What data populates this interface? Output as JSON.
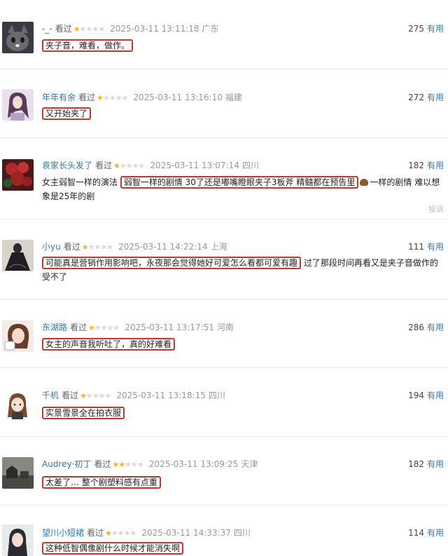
{
  "comments": [
    {
      "user": "-_-",
      "watched": "看过",
      "stars": 1,
      "time": "2025-03-11 13:11:18",
      "location": "广东",
      "votes": "275",
      "useful": "有用",
      "segments": [
        {
          "text": "夹子音，难看，做作。",
          "hl": true
        }
      ]
    },
    {
      "user": "年年有余",
      "watched": "看过",
      "stars": 1,
      "time": "2025-03-11 13:16:10",
      "location": "福建",
      "votes": "272",
      "useful": "有用",
      "segments": [
        {
          "text": "又开始夹了",
          "hl": true
        }
      ]
    },
    {
      "user": "袁家长头发了",
      "watched": "看过",
      "stars": 1,
      "time": "2025-03-11 13:07:14",
      "location": "四川",
      "votes": "182",
      "useful": "有用",
      "segments": [
        {
          "text": "女主弱智一样的演法 ",
          "hl": false
        },
        {
          "text": "弱智一样的剧情 30了还是嘟嘴瞪眼夹子3板斧 精髓都在预告里",
          "hl": true
        },
        {
          "text": "一样的剧情 难以想象是25年的剧",
          "hl": false
        }
      ],
      "report": "投诉"
    },
    {
      "user": "小yu",
      "watched": "看过",
      "stars": 1,
      "time": "2025-03-11 14:22:14",
      "location": "上海",
      "votes": "111",
      "useful": "有用",
      "segments": [
        {
          "text": "可能真是营销作用影响吧，永夜那会觉得她好可爱怎么看都可爱有趣",
          "hl": true
        },
        {
          "text": " 过了那段时间再看又是夹子音做作的受不了",
          "hl": false
        }
      ]
    },
    {
      "user": "东湖路",
      "watched": "看过",
      "stars": 1,
      "time": "2025-03-11 13:17:51",
      "location": "河南",
      "votes": "286",
      "useful": "有用",
      "segments": [
        {
          "text": "女主的声音我听吐了，真的好难看",
          "hl": true
        }
      ]
    },
    {
      "user": "千机",
      "watched": "看过",
      "stars": 1,
      "time": "2025-03-11 13:18:15",
      "location": "四川",
      "votes": "194",
      "useful": "有用",
      "segments": [
        {
          "text": "实景雪景全在拍衣服",
          "hl": true
        }
      ]
    },
    {
      "user": "Audrey·初丁",
      "watched": "看过",
      "stars": 2,
      "time": "2025-03-11 13:09:25",
      "location": "天津",
      "votes": "182",
      "useful": "有用",
      "segments": [
        {
          "text": "太差了… 整个剧塑料感有点重",
          "hl": true
        }
      ]
    },
    {
      "user": "望川小短裙",
      "watched": "看过",
      "stars": 1,
      "time": "2025-03-11 14:33:37",
      "location": "四川",
      "votes": "114",
      "useful": "有用",
      "segments": [
        {
          "text": "这种低智偶像剧什么时候才能消失啊",
          "hl": true
        }
      ]
    }
  ]
}
